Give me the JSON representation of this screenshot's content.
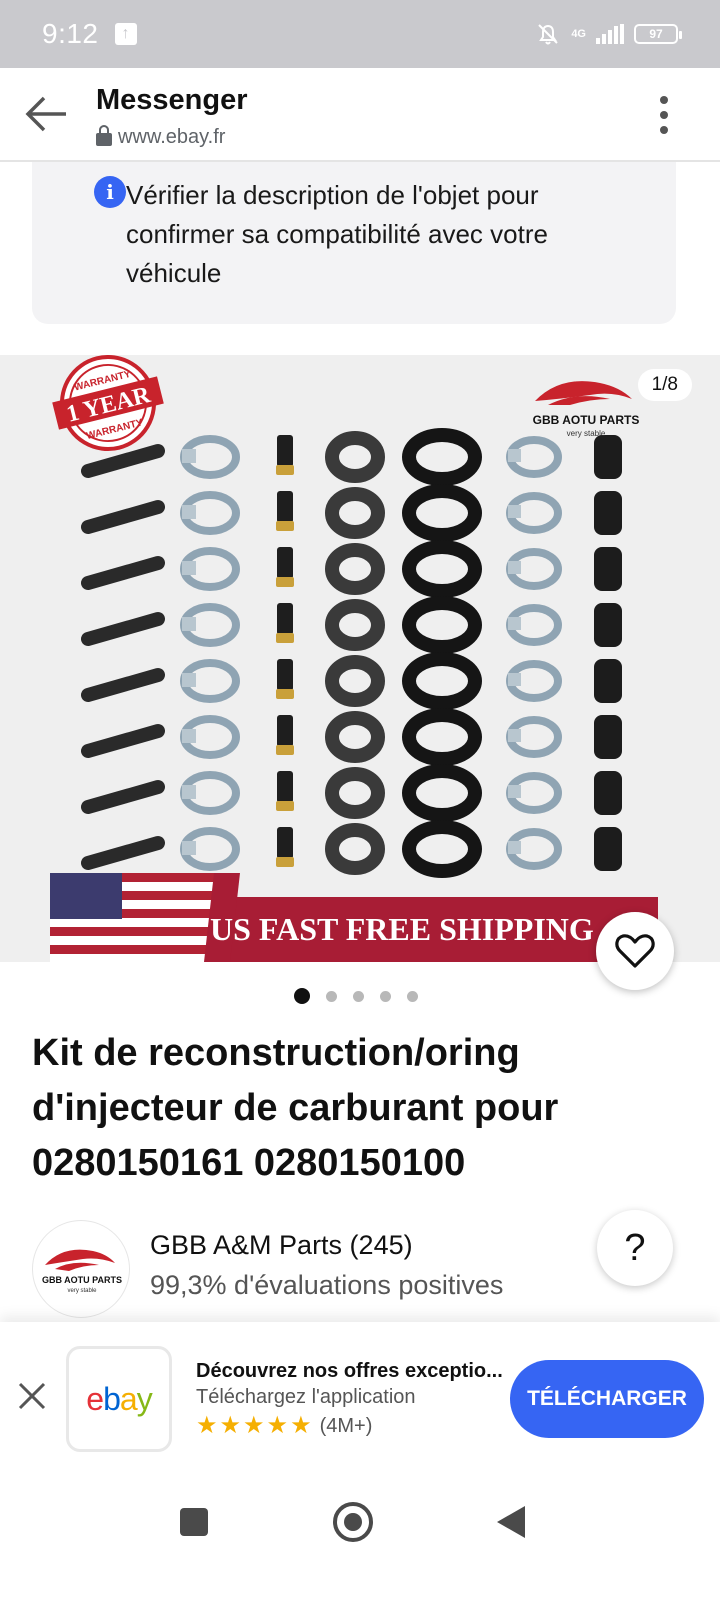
{
  "status_bar": {
    "time": "9:12",
    "network": "4G",
    "battery": "97"
  },
  "browser": {
    "title": "Messenger",
    "url": "www.ebay.fr"
  },
  "notice": {
    "text": "Vérifier la description de l'objet pour confirmer sa compatibilité avec votre véhicule"
  },
  "gallery": {
    "counter": "1/8",
    "badge_line1": "WARRANTY",
    "badge_line2": "1 YEAR",
    "badge_line3": "WARRANTY",
    "brand": "GBB AOTU PARTS",
    "brand_tag": "very stable",
    "shipping_banner": "US FAST FREE SHIPPING",
    "total_images": 8,
    "visible_dots": 5,
    "active_dot": 0
  },
  "product": {
    "title": "Kit de reconstruction/oring d'injecteur de carburant pour 0280150161 0280150100"
  },
  "seller": {
    "name": "GBB A&M Parts (245)",
    "rating": "99,3% d'évaluations positives",
    "logo_text": "GBB AOTU PARTS",
    "logo_tag": "very stable"
  },
  "help": {
    "label": "?"
  },
  "app_banner": {
    "title": "Découvrez nos offres exceptio...",
    "subtitle": "Téléchargez l'application",
    "rating_count": "(4M+)",
    "stars": 5,
    "button": "TÉLÉCHARGER",
    "logo_letters": [
      "e",
      "b",
      "a",
      "y"
    ],
    "logo_colors": [
      "#e53238",
      "#0064d2",
      "#f5af02",
      "#86b817"
    ]
  },
  "colors": {
    "accent": "#3665f3",
    "star": "#f5af02",
    "banner_red": "#a81d35"
  }
}
